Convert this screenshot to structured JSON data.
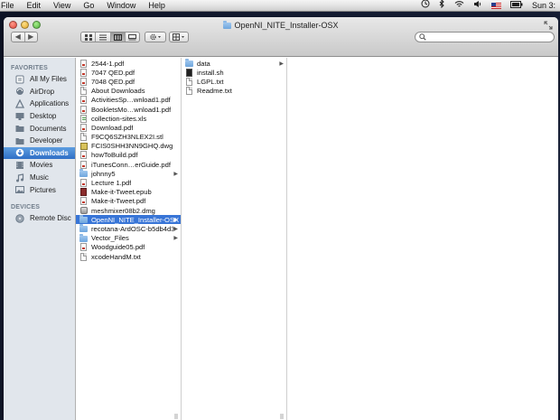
{
  "menubar": {
    "items": [
      "File",
      "Edit",
      "View",
      "Go",
      "Window",
      "Help"
    ],
    "clock": "Sun 3:"
  },
  "window": {
    "title": "OpenNI_NITE_Installer-OSX",
    "search_placeholder": ""
  },
  "toolbar": {
    "back": "◀",
    "forward": "▶"
  },
  "sidebar": {
    "favorites_header": "FAVORITES",
    "favorites": [
      {
        "label": "All My Files",
        "icon": "all-files-icon"
      },
      {
        "label": "AirDrop",
        "icon": "airdrop-icon"
      },
      {
        "label": "Applications",
        "icon": "applications-icon"
      },
      {
        "label": "Desktop",
        "icon": "desktop-icon"
      },
      {
        "label": "Documents",
        "icon": "documents-icon"
      },
      {
        "label": "Developer",
        "icon": "developer-icon"
      },
      {
        "label": "Downloads",
        "icon": "downloads-icon",
        "selected": true
      },
      {
        "label": "Movies",
        "icon": "movies-icon"
      },
      {
        "label": "Music",
        "icon": "music-icon"
      },
      {
        "label": "Pictures",
        "icon": "pictures-icon"
      }
    ],
    "devices_header": "DEVICES",
    "devices": [
      {
        "label": "Remote Disc",
        "icon": "remote-disc-icon"
      }
    ]
  },
  "column1": {
    "items": [
      {
        "label": "2544-1.pdf",
        "type": "pdf"
      },
      {
        "label": "7047 QED.pdf",
        "type": "pdf"
      },
      {
        "label": "7048 QED.pdf",
        "type": "pdf"
      },
      {
        "label": "About Downloads",
        "type": "doc"
      },
      {
        "label": "ActivitiesSp…wnload1.pdf",
        "type": "pdf"
      },
      {
        "label": "BookletsMo…wnload1.pdf",
        "type": "pdf"
      },
      {
        "label": "collection-sites.xls",
        "type": "xls"
      },
      {
        "label": "Download.pdf",
        "type": "pdf"
      },
      {
        "label": "F9CQ6SZH3NLEX2I.stl",
        "type": "doc"
      },
      {
        "label": "FCIS0SHH3NN9GHQ.dwg",
        "type": "dwg"
      },
      {
        "label": "howToBuild.pdf",
        "type": "pdf"
      },
      {
        "label": "iTunesConn…erGuide.pdf",
        "type": "pdf"
      },
      {
        "label": "johnny5",
        "type": "folder",
        "arrow": true
      },
      {
        "label": "Lecture 1.pdf",
        "type": "pdf"
      },
      {
        "label": "Make-it-Tweet.epub",
        "type": "epub"
      },
      {
        "label": "Make-it-Tweet.pdf",
        "type": "pdf"
      },
      {
        "label": "meshmixer08b2.dmg",
        "type": "dmg"
      },
      {
        "label": "OpenNI_NITE_Installer-OSX",
        "type": "folder",
        "arrow": true,
        "selected": true
      },
      {
        "label": "recotana-ArdOSC-b5db4d3",
        "type": "folder",
        "arrow": true
      },
      {
        "label": "Vector_Files",
        "type": "folder",
        "arrow": true
      },
      {
        "label": "Woodguide05.pdf",
        "type": "pdf"
      },
      {
        "label": "xcodeHandM.txt",
        "type": "doc"
      }
    ]
  },
  "column2": {
    "items": [
      {
        "label": "data",
        "type": "folder",
        "arrow": true
      },
      {
        "label": "install.sh",
        "type": "sh"
      },
      {
        "label": "LGPL.txt",
        "type": "doc"
      },
      {
        "label": "Readme.txt",
        "type": "doc"
      }
    ]
  },
  "colors": {
    "selection": "#3875d7",
    "sidebar_bg": "#e1e6ec",
    "sidebar_selected": "#2f6fc6"
  }
}
